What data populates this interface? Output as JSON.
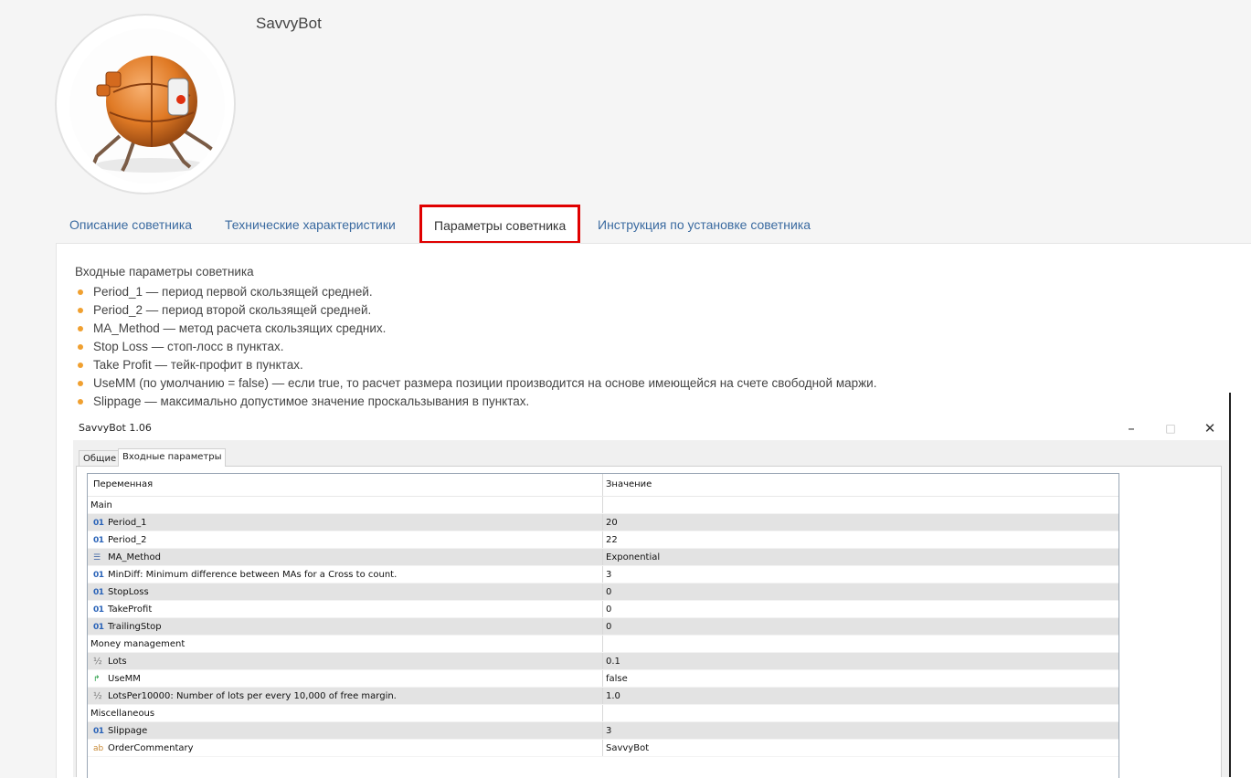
{
  "profile": {
    "name": "SavvyBot"
  },
  "tabs": [
    {
      "label": "Описание советника",
      "active": false
    },
    {
      "label": "Технические характеристики",
      "active": false
    },
    {
      "label": "Параметры советника",
      "active": true
    },
    {
      "label": "Инструкция по установке советника",
      "active": false
    }
  ],
  "content": {
    "title": "Входные параметры советника",
    "items": [
      "Period_1 — период первой скользящей средней.",
      "Period_2 — период второй скользящей средней.",
      "MA_Method — метод расчета скользящих средних.",
      "Stop Loss — стоп-лосс в пунктах.",
      "Take Profit — тейк-профит в пунктах.",
      "UseMM (по умолчанию = false) — если true, то расчет размера позиции производится на основе имеющейся на счете свободной маржи.",
      "Slippage — максимально допустимое значение проскальзывания в пунктах."
    ]
  },
  "dialog": {
    "title": "SavvyBot 1.06",
    "window_buttons": {
      "minimize": "–",
      "maximize": "□",
      "close": "✕"
    },
    "tabs": [
      "Общие",
      "Входные параметры"
    ],
    "headers": {
      "variable": "Переменная",
      "value": "Значение"
    },
    "rows": [
      {
        "type": "group",
        "name": "Main",
        "value": ""
      },
      {
        "icon": "01",
        "icon_name": "int-type-icon",
        "name": "Period_1",
        "value": "20"
      },
      {
        "icon": "01",
        "icon_name": "int-type-icon",
        "name": "Period_2",
        "value": "22"
      },
      {
        "icon": "☰",
        "icon_name": "enum-type-icon",
        "name": "MA_Method",
        "value": "Exponential"
      },
      {
        "icon": "01",
        "icon_name": "int-type-icon",
        "name": "MinDiff: Minimum difference between MAs for a Cross to count.",
        "value": "3"
      },
      {
        "icon": "01",
        "icon_name": "int-type-icon",
        "name": "StopLoss",
        "value": "0"
      },
      {
        "icon": "01",
        "icon_name": "int-type-icon",
        "name": "TakeProfit",
        "value": "0"
      },
      {
        "icon": "01",
        "icon_name": "int-type-icon",
        "name": "TrailingStop",
        "value": "0"
      },
      {
        "type": "group",
        "name": "Money management",
        "value": ""
      },
      {
        "icon": "½",
        "icon_name": "double-type-icon",
        "name": "Lots",
        "value": "0.1"
      },
      {
        "icon": "↱",
        "icon_name": "bool-type-icon",
        "name": "UseMM",
        "value": "false"
      },
      {
        "icon": "½",
        "icon_name": "double-type-icon",
        "name": "LotsPer10000: Number of lots per every 10,000 of free margin.",
        "value": "1.0"
      },
      {
        "type": "group",
        "name": "Miscellaneous",
        "value": ""
      },
      {
        "icon": "01",
        "icon_name": "int-type-icon",
        "name": "Slippage",
        "value": "3"
      },
      {
        "icon": "ab",
        "icon_name": "string-type-icon",
        "name": "OrderCommentary",
        "value": "SavvyBot"
      }
    ]
  },
  "colors": {
    "accent_link": "#3a6aa0",
    "highlight_border": "#e00000",
    "bullet": "#f0a030"
  }
}
